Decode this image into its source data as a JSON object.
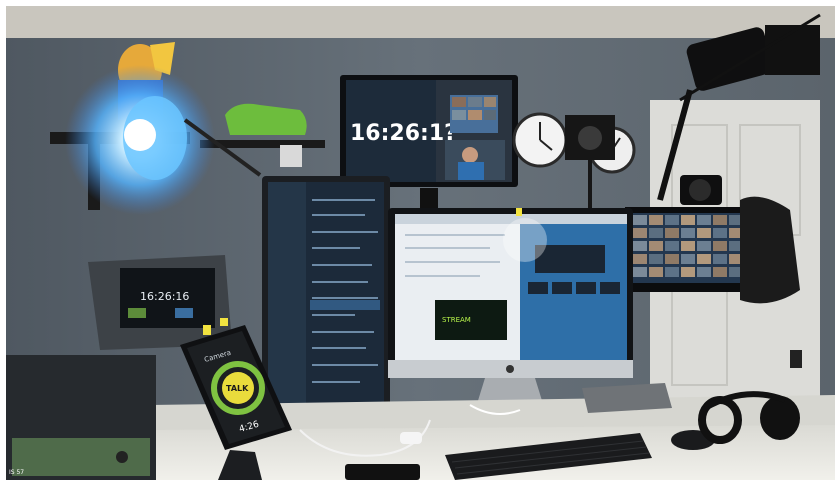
{
  "scene": {
    "top_monitor_clock": "16:26:1?",
    "tablet_title": "Camera",
    "tablet_badge": "TALK",
    "tablet_time": "4:26",
    "recorder_time": "16:26:16",
    "photo_label": "IS 57"
  },
  "colors": {
    "wall": "#5d6770",
    "ceiling": "#c9c6be",
    "desk": "#e9e8e3",
    "door": "#d9d9d6",
    "lamp_glow": "#66c3ff",
    "screen_blue": "#2e6fa8",
    "tally_green": "#7fc241"
  }
}
